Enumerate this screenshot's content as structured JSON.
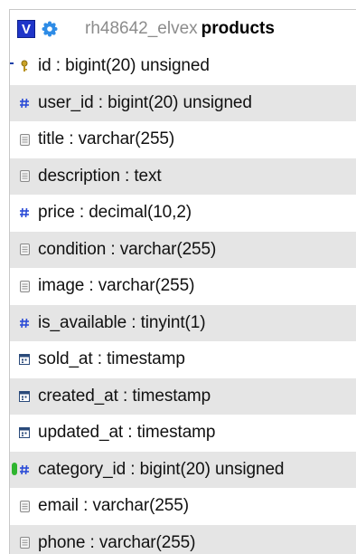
{
  "header": {
    "toggle_label": "V",
    "database": "rh48642_elvex",
    "table": "products"
  },
  "columns": [
    {
      "label": "id : bigint(20) unsigned",
      "icon": "key-icon"
    },
    {
      "label": "user_id : bigint(20) unsigned",
      "icon": "hash-icon"
    },
    {
      "label": "title : varchar(255)",
      "icon": "text-icon"
    },
    {
      "label": "description : text",
      "icon": "text-icon"
    },
    {
      "label": "price : decimal(10,2)",
      "icon": "hash-icon"
    },
    {
      "label": "condition : varchar(255)",
      "icon": "text-icon"
    },
    {
      "label": "image : varchar(255)",
      "icon": "text-icon"
    },
    {
      "label": "is_available : tinyint(1)",
      "icon": "hash-icon"
    },
    {
      "label": "sold_at : timestamp",
      "icon": "calendar-icon"
    },
    {
      "label": "created_at : timestamp",
      "icon": "calendar-icon"
    },
    {
      "label": "updated_at : timestamp",
      "icon": "calendar-icon"
    },
    {
      "label": "category_id : bigint(20) unsigned",
      "icon": "hash-icon"
    },
    {
      "label": "email : varchar(255)",
      "icon": "text-icon"
    },
    {
      "label": "phone : varchar(255)",
      "icon": "text-icon"
    }
  ],
  "colors": {
    "toggle_bg": "#1f35c9",
    "hash_icon": "#2a4bd7",
    "row_alt": "#e5e5e5",
    "db_name": "#8c8c8c"
  }
}
